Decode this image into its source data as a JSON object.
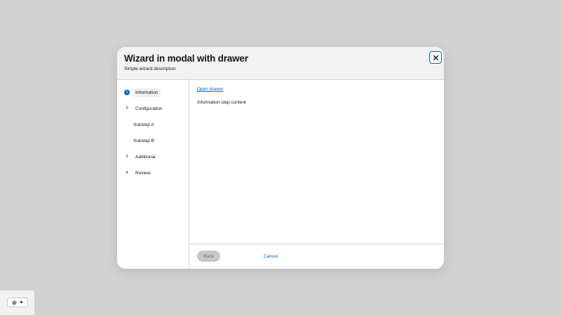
{
  "modal": {
    "title": "Wizard in modal with drawer",
    "description": "Simple wizard description",
    "close_icon": "close-icon"
  },
  "nav": {
    "steps": [
      {
        "number": "1",
        "label": "Information",
        "active": true
      },
      {
        "number": "2",
        "label": "Configuration",
        "active": false
      },
      {
        "number": "",
        "label": "Substep A",
        "active": false
      },
      {
        "number": "",
        "label": "Substep B",
        "active": false
      },
      {
        "number": "3",
        "label": "Additional",
        "active": false
      },
      {
        "number": "4",
        "label": "Review",
        "active": false
      }
    ]
  },
  "body": {
    "drawer_link": "Open drawer",
    "step_content": "Information step content"
  },
  "footer": {
    "back_label": "Back",
    "cancel_label": "Cancel"
  },
  "theme": {
    "icon": "sun-icon",
    "caret_icon": "caret-down-icon"
  },
  "colors": {
    "accent": "#0066cc",
    "backdrop": "#d2d2d2",
    "header_bg": "#f2f2f2",
    "disabled_button": "#c7c7c7"
  }
}
